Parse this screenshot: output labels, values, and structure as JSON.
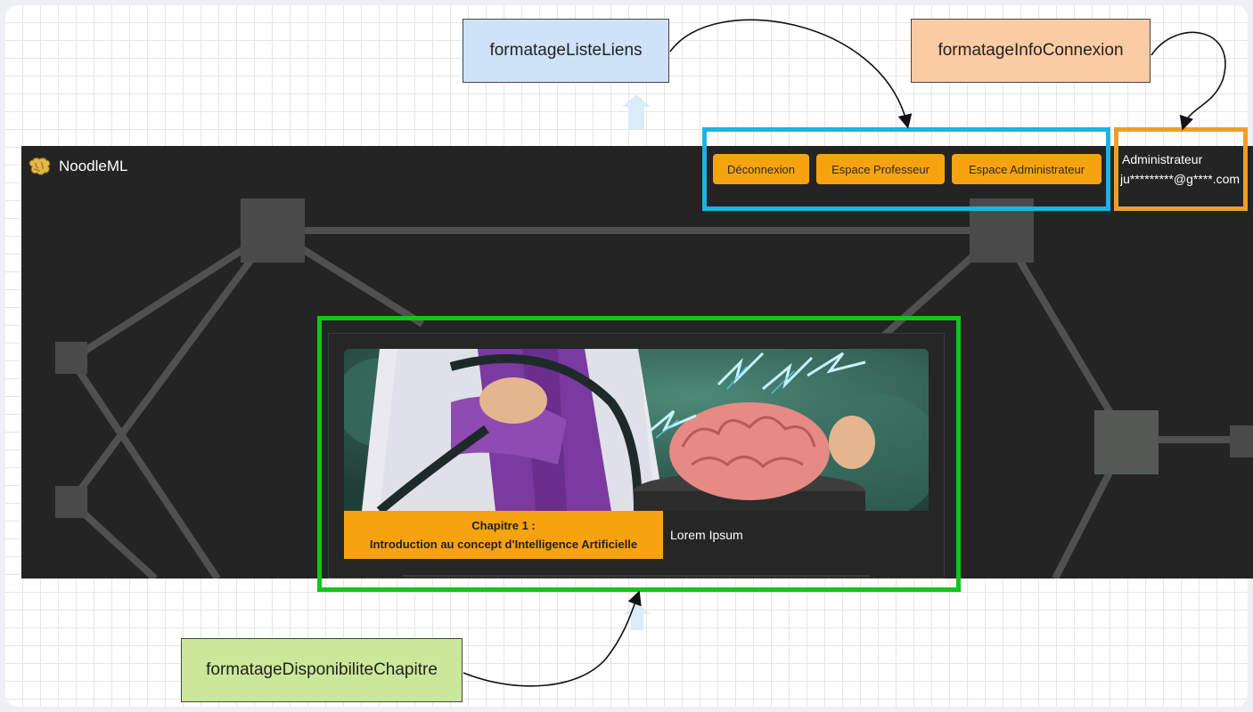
{
  "notes": {
    "liste_liens": "formatageListeLiens",
    "info_connexion": "formatageInfoConnexion",
    "disponibilite_chapitre": "formatageDisponibiliteChapitre"
  },
  "app": {
    "brand_name": "NoodleML",
    "nav": [
      "Déconnexion",
      "Espace Professeur",
      "Espace Administrateur"
    ],
    "user": {
      "role": "Administrateur",
      "email": "ju*********@g****.com"
    },
    "chapter": {
      "label": "Chapitre 1 :",
      "title": "Introduction au concept d'Intelligence Artificielle",
      "description": "Lorem Ipsum"
    }
  },
  "colors": {
    "nav_highlight": "#1bb3e6",
    "user_highlight": "#ef9d2a",
    "chapter_highlight": "#14c41a",
    "accent": "#f7a310",
    "app_background": "#242424"
  }
}
